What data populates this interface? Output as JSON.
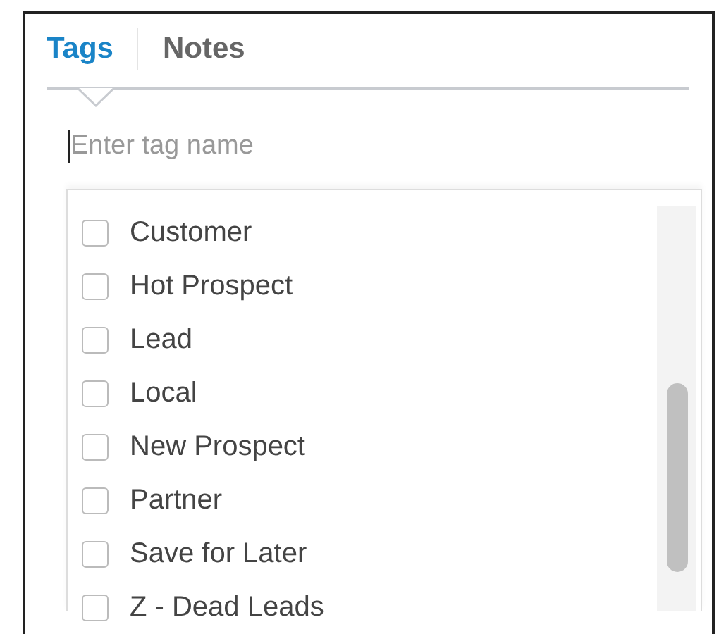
{
  "tabs": [
    {
      "label": "Tags",
      "selected": true
    },
    {
      "label": "Notes",
      "selected": false
    }
  ],
  "tag_input": {
    "placeholder": "Enter tag name"
  },
  "tags": [
    {
      "label": "Customer",
      "checked": false
    },
    {
      "label": "Hot Prospect",
      "checked": false
    },
    {
      "label": "Lead",
      "checked": false
    },
    {
      "label": "Local",
      "checked": false
    },
    {
      "label": "New Prospect",
      "checked": false
    },
    {
      "label": "Partner",
      "checked": false
    },
    {
      "label": "Save for Later",
      "checked": false
    },
    {
      "label": "Z - Dead Leads",
      "checked": false
    }
  ]
}
